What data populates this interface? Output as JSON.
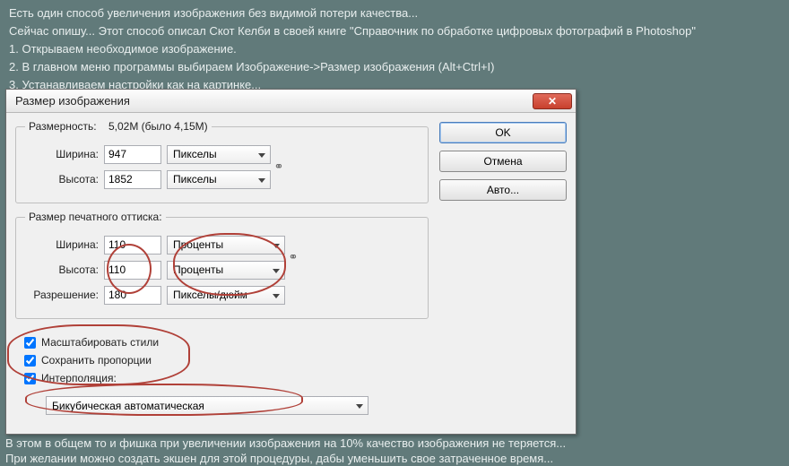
{
  "intro": {
    "l1": "Есть один способ увеличения изображения без видимой потери качества...",
    "l2": "Сейчас опишу... Этот способ описал Скот Келби в своей книге \"Справочник по обработке цифровых фотографий в Photoshop\"",
    "l3": "1. Открываем необходимое изображение.",
    "l4": "2. В главном меню программы выбираем Изображение->Размер изображения (Alt+Ctrl+I)",
    "l5": "3. Устанавливаем настройки как на картинке..."
  },
  "dialog": {
    "title": "Размер изображения",
    "close": "✕",
    "dim_label": "Размерность:",
    "dim_value": "5,02M (было 4,15M)",
    "pixel": {
      "width_label": "Ширина:",
      "width_value": "947",
      "width_unit": "Пикселы",
      "height_label": "Высота:",
      "height_value": "1852",
      "height_unit": "Пикселы"
    },
    "doc_legend": "Размер печатного оттиска:",
    "doc": {
      "width_label": "Ширина:",
      "width_value": "110",
      "width_unit": "Проценты",
      "height_label": "Высота:",
      "height_value": "110",
      "height_unit": "Проценты",
      "res_label": "Разрешение:",
      "res_value": "180",
      "res_unit": "Пикселы/дюйм"
    },
    "checks": {
      "scale_styles": "Масштабировать стили",
      "constrain": "Сохранить пропорции",
      "resample": "Интерполяция:"
    },
    "interp_method": "Бикубическая автоматическая",
    "buttons": {
      "ok": "OK",
      "cancel": "Отмена",
      "auto": "Авто..."
    },
    "link_glyph": "⚭"
  },
  "outro": {
    "l1": "В этом в общем то и фишка при увеличении изображения на 10% качество изображения не теряется...",
    "l2": "При желании можно создать экшен для этой процедуры, дабы уменьшить свое затраченное время..."
  }
}
